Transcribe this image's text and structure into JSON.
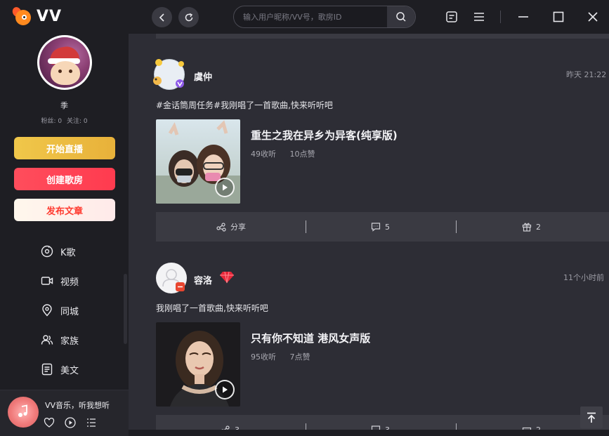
{
  "app": {
    "name": "VV"
  },
  "sidebar": {
    "user_name": "季",
    "fans_label": "粉丝: 0",
    "follow_label": "关注: 0",
    "buttons": {
      "live": "开始直播",
      "create_room": "创建歌房",
      "publish_article": "发布文章"
    },
    "nav": [
      {
        "label": "K歌",
        "icon": "karaoke-icon"
      },
      {
        "label": "视频",
        "icon": "video-icon"
      },
      {
        "label": "同城",
        "icon": "location-icon"
      },
      {
        "label": "家族",
        "icon": "family-icon"
      },
      {
        "label": "美文",
        "icon": "article-icon"
      }
    ]
  },
  "player": {
    "title": "VV音乐，听我想听"
  },
  "search": {
    "placeholder": "输入用户昵称/VV号，歌房ID"
  },
  "colors": {
    "accent_red": "#ff3b4f",
    "accent_gold": "#f0c74a",
    "bg_dark": "#1e1e23",
    "bg_main": "#2d2d35"
  },
  "posts": [
    {
      "user": "虞仲",
      "time": "昨天 21:22",
      "text": "#金话筒周任务#我刚唱了一首歌曲,快来听听吧",
      "song_title": "重生之我在异乡为异客(纯享版)",
      "listens": "49收听",
      "likes": "10点赞",
      "share_label": "分享",
      "comments": "5",
      "gifts": "2"
    },
    {
      "user": "容洛",
      "time": "11个小时前",
      "text": "我刚唱了一首歌曲,快来听听吧",
      "song_title": "只有你不知道 港风女声版",
      "listens": "95收听",
      "likes": "7点赞",
      "share_label": "3",
      "comments": "3",
      "gifts": "2"
    }
  ]
}
